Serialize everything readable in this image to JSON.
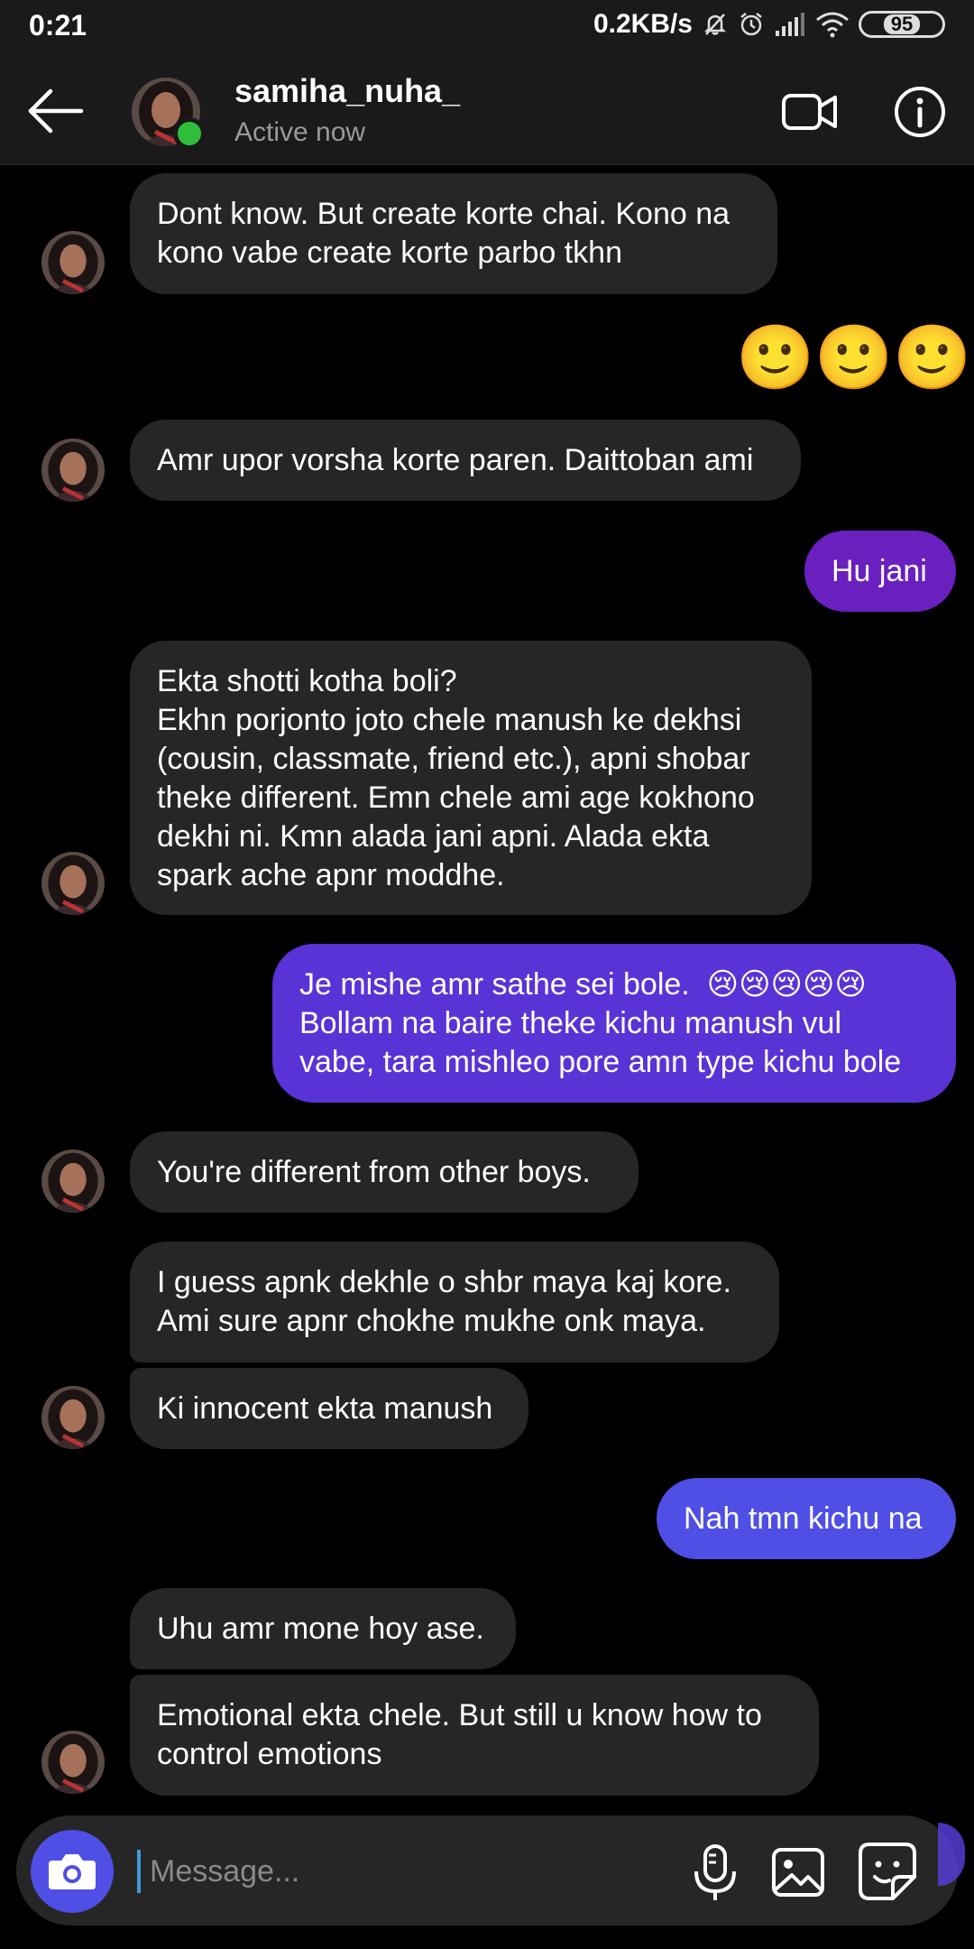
{
  "status_bar": {
    "time": "0:21",
    "net_speed": "0.2KB/s",
    "battery": "95",
    "icons": [
      "mute-icon",
      "alarm-icon",
      "signal-icon",
      "wifi-icon",
      "battery-icon"
    ]
  },
  "header": {
    "username": "samiha_nuha_",
    "status": "Active now",
    "icons": [
      "back-arrow-icon",
      "video-call-icon",
      "info-icon"
    ]
  },
  "messages": [
    {
      "side": "in",
      "text": "Dont know. But create korte chai. Kono na\nkono vabe create korte parbo tkhn"
    },
    {
      "side": "out_emoji",
      "text": "🙂🙂🙂"
    },
    {
      "side": "in",
      "text": "Amr upor vorsha korte paren. Daittoban ami"
    },
    {
      "side": "out",
      "text": "Hu jani"
    },
    {
      "side": "in",
      "text": "Ekta shotti kotha boli?\nEkhn porjonto joto chele manush ke dekhsi\n(cousin, classmate, friend etc.), apni shobar\ntheke different. Emn chele ami age kokhono\ndekhi ni. Kmn alada jani apni. Alada ekta\nspark ache apnr moddhe."
    },
    {
      "side": "out",
      "text": "Je mishe amr sathe sei bole.  😢😢😢😢😢\nBollam na baire theke kichu manush vul\nvabe, tara mishleo pore amn type kichu bole"
    },
    {
      "side": "in",
      "text": "You're different from other boys."
    },
    {
      "side": "in",
      "text": "I guess apnk dekhle o shbr maya kaj kore.\nAmi sure apnr chokhe mukhe onk maya."
    },
    {
      "side": "in",
      "text": "Ki innocent ekta manush"
    },
    {
      "side": "out",
      "text": "Nah tmn kichu na"
    },
    {
      "side": "in",
      "text": "Uhu amr mone hoy ase."
    },
    {
      "side": "in",
      "text": "Emotional ekta chele. But still u know how to\ncontrol emotions"
    }
  ],
  "composer": {
    "placeholder": "Message...",
    "icons": [
      "camera-icon",
      "microphone-icon",
      "gallery-icon",
      "sticker-icon"
    ]
  },
  "colors": {
    "incoming_bubble": "#262626",
    "outgoing_dark": "#6a1fbf",
    "outgoing_mid": "#5a33d6",
    "outgoing_light": "#4f4fe6",
    "online": "#2fbf3a"
  }
}
